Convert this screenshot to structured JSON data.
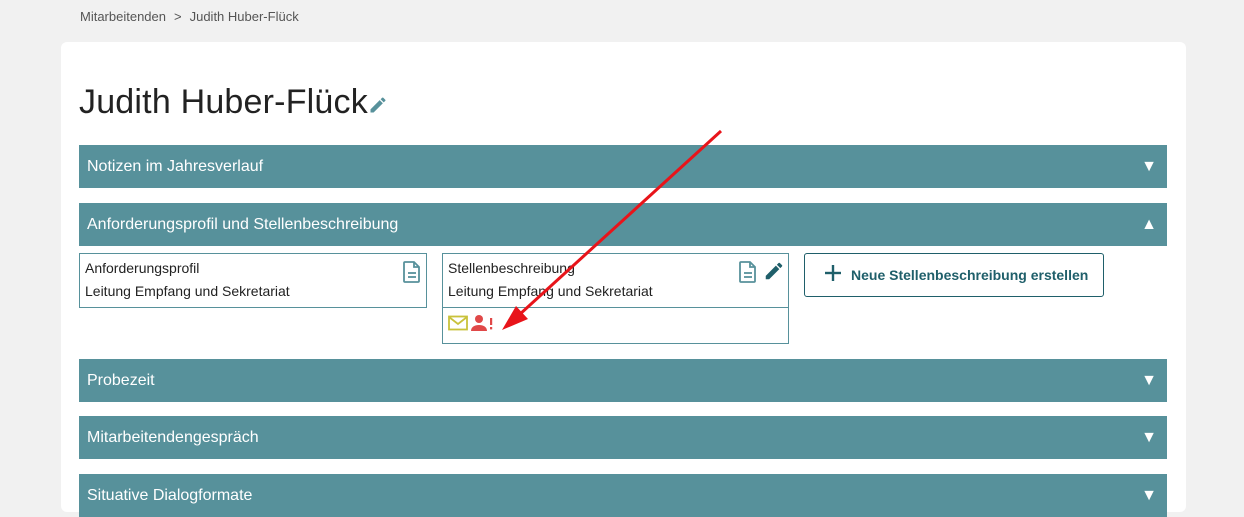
{
  "breadcrumb": {
    "root": "Mitarbeitenden",
    "separator": ">",
    "current": "Judith Huber-Flück"
  },
  "page": {
    "title": "Judith Huber-Flück"
  },
  "sections": [
    {
      "label": "Notizen im Jahresverlauf",
      "arrow": "▼",
      "expanded": false
    },
    {
      "label": "Anforderungsprofil und Stellenbeschreibung",
      "arrow": "▲",
      "expanded": true
    },
    {
      "label": "Probezeit",
      "arrow": "▼",
      "expanded": false
    },
    {
      "label": "Mitarbeitendengespräch",
      "arrow": "▼",
      "expanded": false
    },
    {
      "label": "Situative Dialogformate",
      "arrow": "▼",
      "expanded": false
    }
  ],
  "documents": {
    "anforderungsprofil": {
      "title": "Anforderungsprofil",
      "subtitle": "Leitung Empfang und Sekretariat"
    },
    "stellenbeschreibung": {
      "title": "Stellenbeschreibung",
      "subtitle": "Leitung Empfang und Sekretariat",
      "status_icons": [
        "envelope-icon",
        "person-alert-icon"
      ]
    }
  },
  "actions": {
    "new_job_description": "Neue Stellenbeschreibung erstellen"
  },
  "colors": {
    "accent": "#57919b",
    "dark_accent": "#1f5f6a",
    "envelope": "#c9c23b",
    "alert": "#e04848",
    "annotation_arrow": "#e8141a"
  }
}
